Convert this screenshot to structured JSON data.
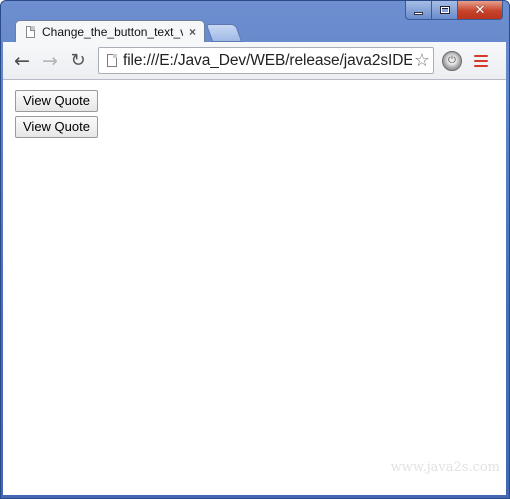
{
  "window": {
    "controls": {
      "minimize": "–",
      "maximize": "□",
      "close": "✕"
    }
  },
  "tabs": [
    {
      "title": "Change_the_button_text_v",
      "close": "×",
      "active": true
    }
  ],
  "toolbar": {
    "back": "←",
    "forward": "→",
    "reload": "↻",
    "url": "file:///E:/Java_Dev/WEB/release/java2sIDE",
    "bookmark": "☆"
  },
  "page": {
    "buttons": [
      {
        "label": "View Quote"
      },
      {
        "label": "View Quote"
      }
    ],
    "watermark": "www.java2s.com"
  },
  "colors": {
    "menu_accent": "#d43a2b",
    "frame": "#4a6fbd"
  }
}
